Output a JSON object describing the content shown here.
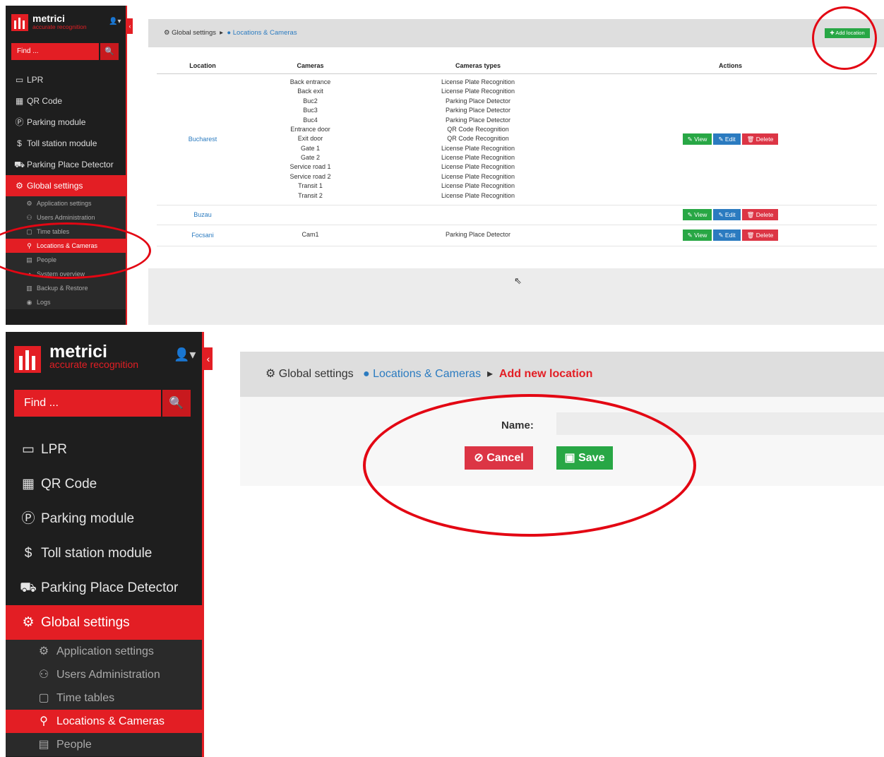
{
  "brand": {
    "name": "metrici",
    "tagline": "accurate recognition"
  },
  "search": {
    "placeholder": "Find ..."
  },
  "nav": {
    "items": [
      "LPR",
      "QR Code",
      "Parking module",
      "Toll station module",
      "Parking Place Detector",
      "Global settings"
    ],
    "sub_items": [
      "Application settings",
      "Users Administration",
      "Time tables",
      "Locations & Cameras",
      "People",
      "System overview",
      "Backup & Restore",
      "Logs"
    ]
  },
  "panel1": {
    "breadcrumb": {
      "root": "Global settings",
      "current": "Locations & Cameras"
    },
    "add_button": "Add location",
    "table": {
      "headers": [
        "Location",
        "Cameras",
        "Cameras types",
        "Actions"
      ],
      "rows": [
        {
          "location": "Bucharest",
          "cameras": [
            "Back entrance",
            "Back exit",
            "Buc2",
            "Buc3",
            "Buc4",
            "Entrance door",
            "Exit door",
            "Gate 1",
            "Gate 2",
            "Service road 1",
            "Service road 2",
            "Transit 1",
            "Transit 2"
          ],
          "types": [
            "License Plate Recognition",
            "License Plate Recognition",
            "Parking Place Detector",
            "Parking Place Detector",
            "Parking Place Detector",
            "QR Code Recognition",
            "QR Code Recognition",
            "License Plate Recognition",
            "License Plate Recognition",
            "License Plate Recognition",
            "License Plate Recognition",
            "License Plate Recognition",
            "License Plate Recognition"
          ]
        },
        {
          "location": "Buzau",
          "cameras": [],
          "types": []
        },
        {
          "location": "Focsani",
          "cameras": [
            "Cam1"
          ],
          "types": [
            "Parking Place Detector"
          ]
        }
      ],
      "actions": {
        "view": "View",
        "edit": "Edit",
        "delete": "Delete"
      }
    }
  },
  "panel2": {
    "breadcrumb": {
      "root": "Global settings",
      "parent": "Locations & Cameras",
      "current": "Add new location"
    },
    "form": {
      "name_label": "Name:",
      "name_value": "",
      "cancel": "Cancel",
      "save": "Save"
    }
  },
  "colors": {
    "accent": "#e31e24",
    "link": "#2b7bc0",
    "success": "#28a745",
    "danger": "#dc3545",
    "sidebar": "#1e1e1e",
    "annotation": "#e30613"
  },
  "icons": {
    "nav": [
      "video-camera-icon",
      "qrcode-icon",
      "parking-icon",
      "dollar-icon",
      "car-icon",
      "cogs-icon"
    ],
    "sub": [
      "gear-icon",
      "users-icon",
      "calendar-icon",
      "map-marker-icon",
      "id-card-icon",
      "dashboard-icon",
      "database-icon",
      "eye-icon"
    ]
  }
}
